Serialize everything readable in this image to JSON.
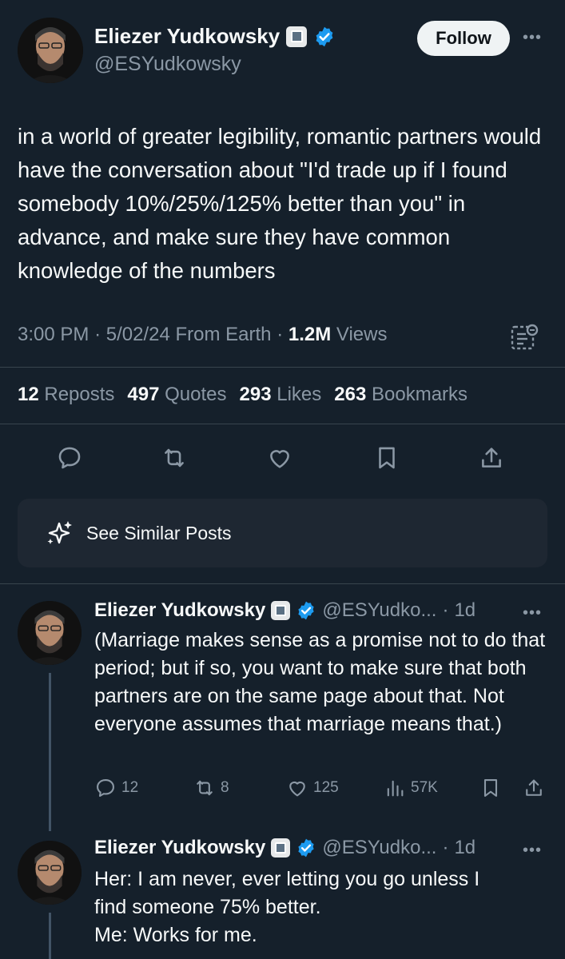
{
  "main_tweet": {
    "author_name": "Eliezer Yudkowsky",
    "handle": "@ESYudkowsky",
    "follow_label": "Follow",
    "more_label": "•••",
    "text": "in a world of greater legibility, romantic partners would have the conversation about \"I'd trade up if I found somebody 10%/25%/125% better than you\" in advance, and make sure they have common knowledge of the numbers",
    "time": "3:00 PM",
    "date": "5/02/24",
    "location": "From Earth",
    "views_count": "1.2M",
    "views_label": "Views",
    "sep": "·",
    "stats": {
      "reposts_count": "12",
      "reposts_label": "Reposts",
      "quotes_count": "497",
      "quotes_label": "Quotes",
      "likes_count": "293",
      "likes_label": "Likes",
      "bookmarks_count": "263",
      "bookmarks_label": "Bookmarks"
    }
  },
  "similar_posts": {
    "label": "See Similar Posts"
  },
  "replies": [
    {
      "author_name": "Eliezer Yudkowsky",
      "handle": "@ESYudko...",
      "time": "1d",
      "text": "(Marriage makes sense as a promise not to do that period; but if so, you want to make sure that both partners are on the same page about that.  Not everyone assumes that marriage means that.)",
      "replies_count": "12",
      "reposts_count": "8",
      "likes_count": "125",
      "views_count": "57K"
    },
    {
      "author_name": "Eliezer Yudkowsky",
      "handle": "@ESYudko...",
      "time": "1d",
      "text": "Her:  I am never, ever letting you go unless I\nfind someone 75% better.\nMe:  Works for me."
    }
  ],
  "colors": {
    "background": "#15202b",
    "verified": "#1d9bf0",
    "secondary_text": "#8b98a5",
    "accent_line": "#425466"
  }
}
